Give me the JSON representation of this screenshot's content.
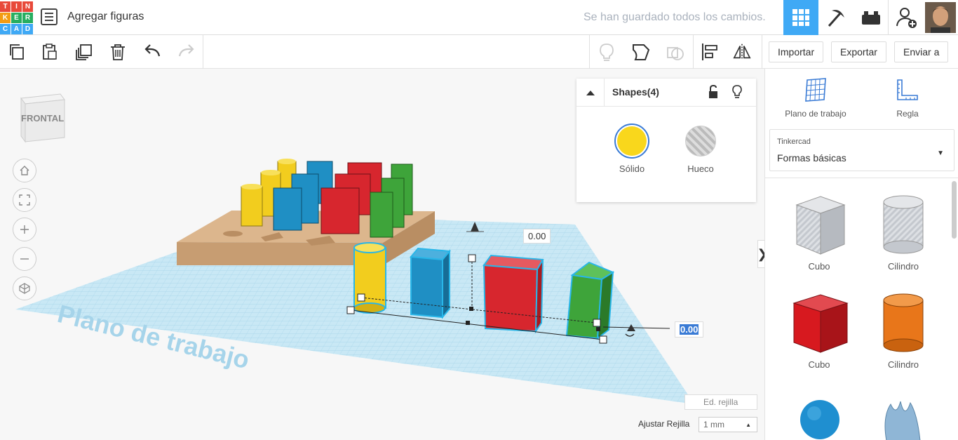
{
  "app": {
    "logo_letters": [
      "T",
      "I",
      "N",
      "K",
      "E",
      "R",
      "C",
      "A",
      "D"
    ],
    "logo_colors": [
      "#e8493a",
      "#e8493a",
      "#e8493a",
      "#f39c12",
      "#27ae60",
      "#27ae60",
      "#3fa9f5",
      "#3fa9f5",
      "#3fa9f5"
    ],
    "title": "Agregar figuras",
    "saved_status": "Se han guardado todos los cambios."
  },
  "header_icons": [
    "list-icon",
    "grid-view-icon",
    "pickaxe-icon",
    "bricks-icon",
    "add-user-icon",
    "avatar"
  ],
  "toolbar": {
    "left_icons": [
      "copy-icon",
      "paste-icon",
      "duplicate-icon",
      "delete-icon",
      "undo-icon",
      "redo-icon"
    ],
    "right_icons": [
      "lightbulb-icon",
      "shape-outline-icon",
      "group-icon",
      "align-icon",
      "mirror-icon"
    ],
    "import_label": "Importar",
    "export_label": "Exportar",
    "send_label": "Enviar a"
  },
  "viewcube": {
    "label": "FRONTAL"
  },
  "workplane": {
    "watermark": "Plano de trabajo",
    "dimension_top": "0.00",
    "dimension_right": "0.00",
    "edit_grid_label": "Ed. rejilla",
    "snap_grid_label": "Ajustar Rejilla",
    "snap_grid_value": "1 mm"
  },
  "inspector": {
    "title": "Shapes(4)",
    "solid_label": "Sólido",
    "hole_label": "Hueco",
    "solid_color": "#f9d71c"
  },
  "rightpanel": {
    "workplane_label": "Plano de trabajo",
    "ruler_label": "Regla",
    "library_category": "Tinkercad",
    "library_name": "Formas básicas",
    "shapes": [
      {
        "label": "Cubo",
        "color": "#c8ccd2"
      },
      {
        "label": "Cilindro",
        "color": "#c8ccd2"
      },
      {
        "label": "Cubo",
        "color": "#d7191f"
      },
      {
        "label": "Cilindro",
        "color": "#e8761a"
      }
    ],
    "next_row_colors": [
      "#1f8fd0",
      "#8fb6d6"
    ]
  },
  "colors": {
    "accent": "#3fa9f5",
    "yellow": "#f2cd1e",
    "blue": "#1f8fc4",
    "red": "#d7262e",
    "green": "#3ea43a",
    "wood": "#dcb68d",
    "grid": "#b8dff0"
  }
}
